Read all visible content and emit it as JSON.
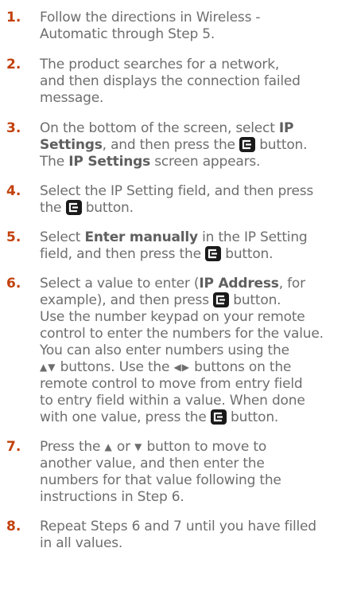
{
  "colors": {
    "step_number": "#c2410c",
    "text": "#6e6e6e",
    "icon_bg": "#1a1a1a"
  },
  "icons": {
    "enter": "enter-key-icon",
    "up_down": "up-down-arrows-icon",
    "left_right": "left-right-arrows-icon"
  },
  "steps": [
    {
      "number": "1.",
      "lines": [
        "Follow the directions in Wireless -",
        "Automatic through Step 5."
      ]
    },
    {
      "number": "2.",
      "lines": [
        "The product searches for a network,",
        "and then displays the connection failed",
        "message."
      ]
    },
    {
      "number": "3.",
      "l1a": "On the bottom of the screen, select ",
      "l1b": "IP",
      "l2a": "Settings",
      "l2b": ", and then press the ",
      "l2c": " button.",
      "l3a": "The ",
      "l3b": "IP Settings",
      "l3c": " screen appears."
    },
    {
      "number": "4.",
      "l1": "Select the IP Setting field, and then press",
      "l2a": "the ",
      "l2b": " button."
    },
    {
      "number": "5.",
      "l1a": "Select ",
      "l1b": "Enter manually",
      "l1c": " in the IP Setting",
      "l2a": "field, and then press the ",
      "l2b": " button."
    },
    {
      "number": "6.",
      "l1a": "Select a value to enter (",
      "l1b": "IP Address",
      "l1c": ", for",
      "l2a": "example), and then press ",
      "l2b": " button.",
      "l3": "Use the number keypad on your remote",
      "l4": "control to enter the numbers for the value.",
      "l5": "You can also enter numbers using the",
      "l6a": "▲▼",
      "l6b": " buttons. Use the ",
      "l6c": "◀▶",
      "l6d": " buttons on the",
      "l7": "remote control to move from entry field",
      "l8": "to entry field within a value. When done",
      "l9a": "with one value, press the ",
      "l9b": " button."
    },
    {
      "number": "7.",
      "l1a": "Press the ",
      "l1b": "▲",
      "l1c": " or ",
      "l1d": "▼",
      "l1e": " button to move to",
      "l2": "another value, and then enter the",
      "l3": "numbers for that value following the",
      "l4": "instructions in Step 6."
    },
    {
      "number": "8.",
      "lines": [
        "Repeat Steps 6 and 7 until you have filled",
        "in all values."
      ]
    }
  ]
}
